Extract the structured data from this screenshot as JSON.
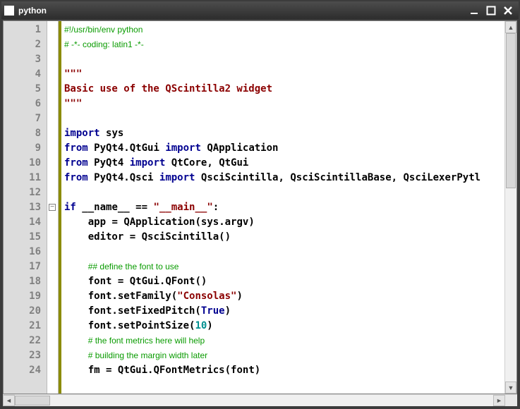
{
  "window": {
    "title": "python"
  },
  "editor": {
    "visible_first_line": 1,
    "visible_last_line": 24,
    "fold_marker_line": 13,
    "lines": [
      {
        "n": 1,
        "tokens": [
          [
            "comment",
            "#!/usr/bin/env python"
          ]
        ]
      },
      {
        "n": 2,
        "tokens": [
          [
            "comment",
            "# -*- coding: latin1 -*-"
          ]
        ]
      },
      {
        "n": 3,
        "tokens": []
      },
      {
        "n": 4,
        "tokens": [
          [
            "docstr",
            "\"\"\""
          ]
        ]
      },
      {
        "n": 5,
        "tokens": [
          [
            "docstr",
            "Basic use of the QScintilla2 widget"
          ]
        ]
      },
      {
        "n": 6,
        "tokens": [
          [
            "docstr",
            "\"\"\""
          ]
        ]
      },
      {
        "n": 7,
        "tokens": []
      },
      {
        "n": 8,
        "tokens": [
          [
            "kw",
            "import"
          ],
          [
            "sp",
            " "
          ],
          [
            "ident",
            "sys"
          ]
        ]
      },
      {
        "n": 9,
        "tokens": [
          [
            "kw",
            "from"
          ],
          [
            "sp",
            " "
          ],
          [
            "ident",
            "PyQt4.QtGui"
          ],
          [
            "sp",
            " "
          ],
          [
            "kw",
            "import"
          ],
          [
            "sp",
            " "
          ],
          [
            "ident",
            "QApplication"
          ]
        ]
      },
      {
        "n": 10,
        "tokens": [
          [
            "kw",
            "from"
          ],
          [
            "sp",
            " "
          ],
          [
            "ident",
            "PyQt4"
          ],
          [
            "sp",
            " "
          ],
          [
            "kw",
            "import"
          ],
          [
            "sp",
            " "
          ],
          [
            "ident",
            "QtCore, QtGui"
          ]
        ]
      },
      {
        "n": 11,
        "tokens": [
          [
            "kw",
            "from"
          ],
          [
            "sp",
            " "
          ],
          [
            "ident",
            "PyQt4.Qsci"
          ],
          [
            "sp",
            " "
          ],
          [
            "kw",
            "import"
          ],
          [
            "sp",
            " "
          ],
          [
            "ident",
            "QsciScintilla, QsciScintillaBase, QsciLexerPytl"
          ]
        ]
      },
      {
        "n": 12,
        "tokens": []
      },
      {
        "n": 13,
        "tokens": [
          [
            "kw",
            "if"
          ],
          [
            "sp",
            " "
          ],
          [
            "ident",
            "__name__"
          ],
          [
            "sp",
            " "
          ],
          [
            "op",
            "=="
          ],
          [
            "sp",
            " "
          ],
          [
            "str",
            "\"__main__\""
          ],
          [
            "op",
            ":"
          ]
        ]
      },
      {
        "n": 14,
        "tokens": [
          [
            "sp",
            "    "
          ],
          [
            "ident",
            "app"
          ],
          [
            "sp",
            " "
          ],
          [
            "op",
            "="
          ],
          [
            "sp",
            " "
          ],
          [
            "ident",
            "QApplication(sys.argv)"
          ]
        ]
      },
      {
        "n": 15,
        "tokens": [
          [
            "sp",
            "    "
          ],
          [
            "ident",
            "editor"
          ],
          [
            "sp",
            " "
          ],
          [
            "op",
            "="
          ],
          [
            "sp",
            " "
          ],
          [
            "ident",
            "QsciScintilla()"
          ]
        ]
      },
      {
        "n": 16,
        "tokens": []
      },
      {
        "n": 17,
        "tokens": [
          [
            "sp",
            "    "
          ],
          [
            "comment",
            "## define the font to use"
          ]
        ]
      },
      {
        "n": 18,
        "tokens": [
          [
            "sp",
            "    "
          ],
          [
            "ident",
            "font"
          ],
          [
            "sp",
            " "
          ],
          [
            "op",
            "="
          ],
          [
            "sp",
            " "
          ],
          [
            "ident",
            "QtGui.QFont()"
          ]
        ]
      },
      {
        "n": 19,
        "tokens": [
          [
            "sp",
            "    "
          ],
          [
            "ident",
            "font.setFamily("
          ],
          [
            "str",
            "\"Consolas\""
          ],
          [
            "ident",
            ")"
          ]
        ]
      },
      {
        "n": 20,
        "tokens": [
          [
            "sp",
            "    "
          ],
          [
            "ident",
            "font.setFixedPitch("
          ],
          [
            "kw",
            "True"
          ],
          [
            "ident",
            ")"
          ]
        ]
      },
      {
        "n": 21,
        "tokens": [
          [
            "sp",
            "    "
          ],
          [
            "ident",
            "font.setPointSize("
          ],
          [
            "num",
            "10"
          ],
          [
            "ident",
            ")"
          ]
        ]
      },
      {
        "n": 22,
        "tokens": [
          [
            "sp",
            "    "
          ],
          [
            "comment",
            "# the font metrics here will help"
          ]
        ]
      },
      {
        "n": 23,
        "tokens": [
          [
            "sp",
            "    "
          ],
          [
            "comment",
            "# building the margin width later"
          ]
        ]
      },
      {
        "n": 24,
        "tokens": [
          [
            "sp",
            "    "
          ],
          [
            "ident",
            "fm"
          ],
          [
            "sp",
            " "
          ],
          [
            "op",
            "="
          ],
          [
            "sp",
            " "
          ],
          [
            "ident",
            "QtGui.QFontMetrics(font)"
          ]
        ]
      }
    ]
  }
}
